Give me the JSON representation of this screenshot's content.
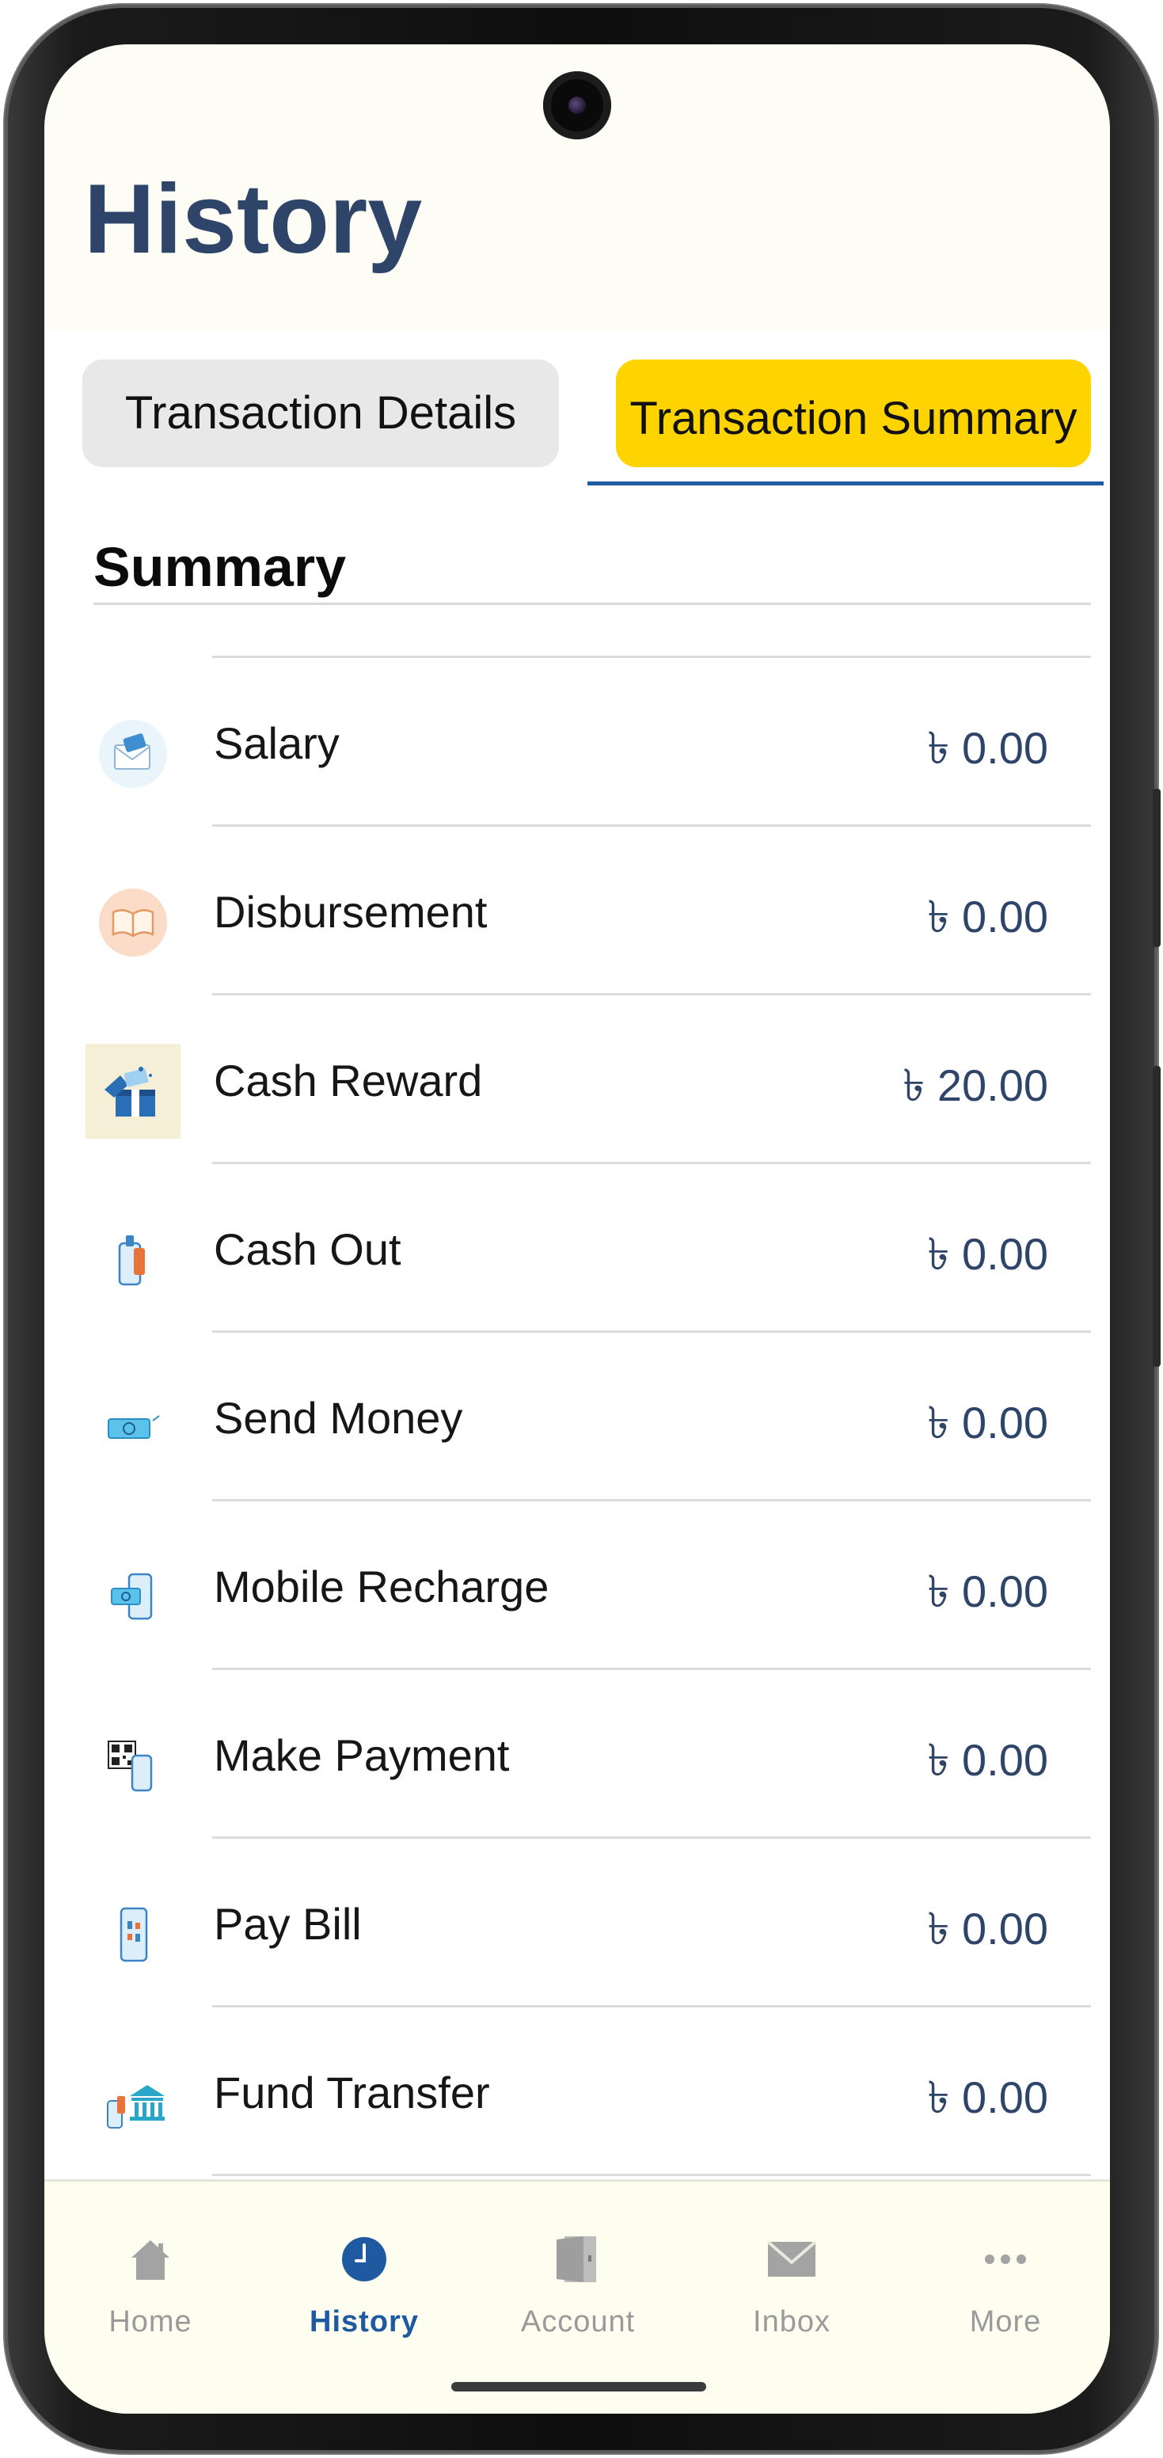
{
  "header": {
    "title": "History"
  },
  "tabs": [
    {
      "label": "Transaction Details",
      "active": false
    },
    {
      "label": "Transaction Summary",
      "active": true
    }
  ],
  "summary": {
    "title": "Summary",
    "items": [
      {
        "label": "Salary",
        "amount": "৳ 0.00",
        "icon": "salary-envelope-icon"
      },
      {
        "label": "Disbursement",
        "amount": "৳ 0.00",
        "icon": "disbursement-book-icon"
      },
      {
        "label": "Cash Reward",
        "amount": "৳ 20.00",
        "icon": "cash-reward-gift-icon"
      },
      {
        "label": "Cash Out",
        "amount": "৳ 0.00",
        "icon": "cash-out-phone-icon"
      },
      {
        "label": "Send Money",
        "amount": "৳ 0.00",
        "icon": "send-money-note-icon"
      },
      {
        "label": "Mobile Recharge",
        "amount": "৳ 0.00",
        "icon": "mobile-recharge-icon"
      },
      {
        "label": "Make Payment",
        "amount": "৳ 0.00",
        "icon": "make-payment-qr-icon"
      },
      {
        "label": "Pay Bill",
        "amount": "৳ 0.00",
        "icon": "pay-bill-phone-icon"
      },
      {
        "label": "Fund Transfer",
        "amount": "৳ 0.00",
        "icon": "fund-transfer-bank-icon"
      }
    ]
  },
  "bottom_nav": [
    {
      "label": "Home",
      "icon": "home-icon",
      "active": false
    },
    {
      "label": "History",
      "icon": "clock-icon",
      "active": true
    },
    {
      "label": "Account",
      "icon": "account-door-icon",
      "active": false
    },
    {
      "label": "Inbox",
      "icon": "envelope-icon",
      "active": false
    },
    {
      "label": "More",
      "icon": "more-dots-icon",
      "active": false
    }
  ],
  "colors": {
    "title": "#2e4468",
    "active_tab": "#fdd400",
    "accent_blue": "#1f5aa0",
    "inactive_nav": "#9a9a9a"
  }
}
